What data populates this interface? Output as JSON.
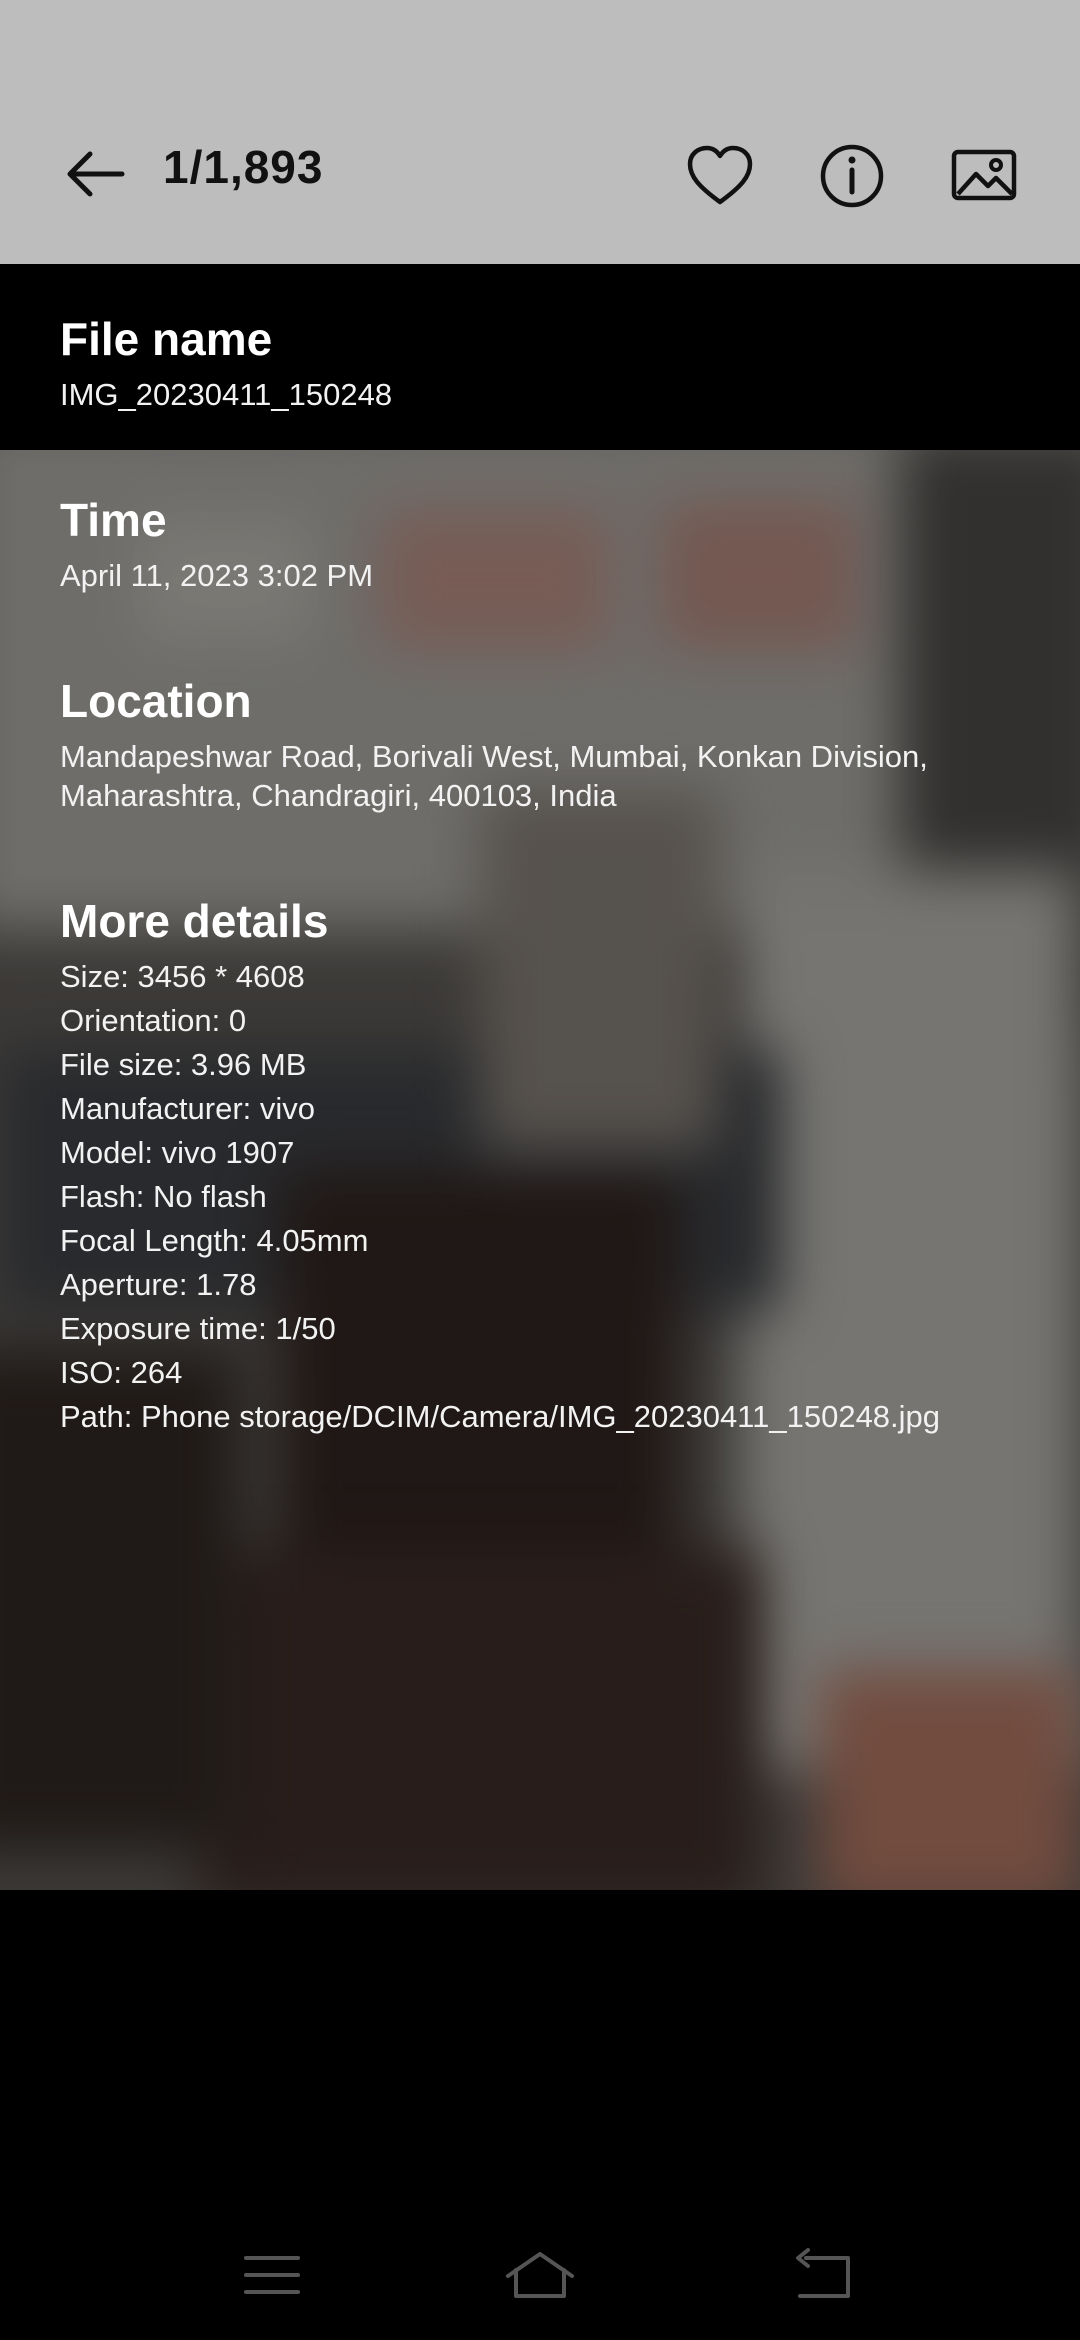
{
  "header": {
    "counter": "1/1,893",
    "icons": [
      "back-arrow-icon",
      "heart-icon",
      "info-icon",
      "gallery-icon"
    ]
  },
  "file_name": {
    "label": "File name",
    "value": "IMG_20230411_150248"
  },
  "time": {
    "label": "Time",
    "value": "April 11, 2023 3:02 PM"
  },
  "location": {
    "label": "Location",
    "line1": "Mandapeshwar Road, Borivali West, Mumbai, Konkan Division,",
    "line2": "Maharashtra, Chandragiri, 400103, India"
  },
  "more_details": {
    "label": "More details",
    "items": [
      "Size: 3456 * 4608",
      "Orientation: 0",
      "File size: 3.96 MB",
      "Manufacturer: vivo",
      "Model: vivo 1907",
      "Flash: No flash",
      "Focal Length: 4.05mm",
      "Aperture: 1.78",
      "Exposure time: 1/50",
      "ISO: 264",
      "Path: Phone storage/DCIM/Camera/IMG_20230411_150248.jpg"
    ]
  },
  "nav": {
    "icons": [
      "menu-icon",
      "home-icon",
      "back-icon"
    ]
  },
  "colors": {
    "topbar": "#bdbdbd",
    "background": "#000000",
    "text": "#ffffff"
  }
}
